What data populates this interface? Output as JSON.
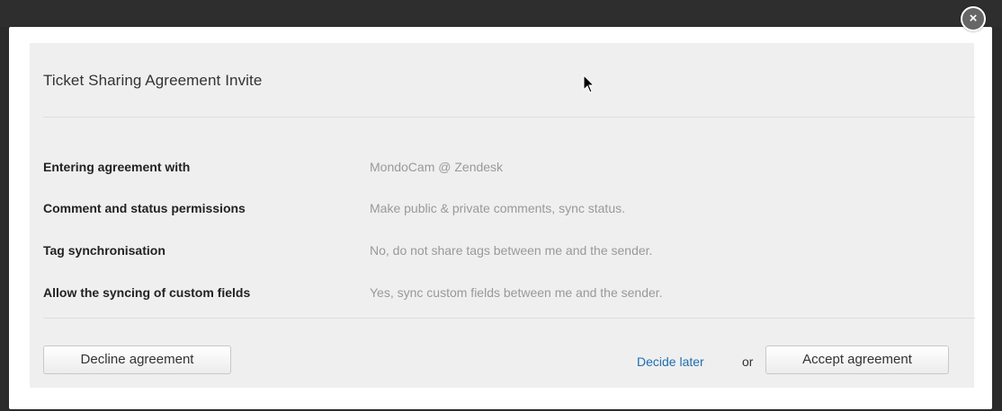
{
  "modal": {
    "title": "Ticket Sharing Agreement Invite",
    "close_glyph": "×",
    "close_icon": "close-icon"
  },
  "details": [
    {
      "label": "Entering agreement with",
      "value": "MondoCam @ Zendesk"
    },
    {
      "label": "Comment and status permissions",
      "value": "Make public & private comments, sync status."
    },
    {
      "label": "Tag synchronisation",
      "value": "No, do not share tags between me and the sender."
    },
    {
      "label": "Allow the syncing of custom fields",
      "value": "Yes, sync custom fields between me and the sender."
    }
  ],
  "actions": {
    "decline_label": "Decline agreement",
    "decide_later_label": "Decide later",
    "or_text": "or",
    "accept_label": "Accept agreement"
  },
  "colors": {
    "link": "#1f6fae",
    "panel_bg": "#efefef",
    "value_text": "#999999"
  }
}
